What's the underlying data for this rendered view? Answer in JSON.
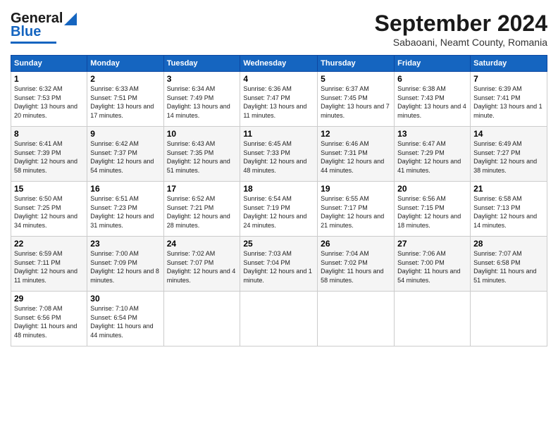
{
  "logo": {
    "part1": "General",
    "part2": "Blue"
  },
  "header": {
    "month_title": "September 2024",
    "subtitle": "Sabaoani, Neamt County, Romania"
  },
  "weekdays": [
    "Sunday",
    "Monday",
    "Tuesday",
    "Wednesday",
    "Thursday",
    "Friday",
    "Saturday"
  ],
  "weeks": [
    [
      {
        "day": "1",
        "sunrise": "6:32 AM",
        "sunset": "7:53 PM",
        "daylight": "13 hours and 20 minutes."
      },
      {
        "day": "2",
        "sunrise": "6:33 AM",
        "sunset": "7:51 PM",
        "daylight": "13 hours and 17 minutes."
      },
      {
        "day": "3",
        "sunrise": "6:34 AM",
        "sunset": "7:49 PM",
        "daylight": "13 hours and 14 minutes."
      },
      {
        "day": "4",
        "sunrise": "6:36 AM",
        "sunset": "7:47 PM",
        "daylight": "13 hours and 11 minutes."
      },
      {
        "day": "5",
        "sunrise": "6:37 AM",
        "sunset": "7:45 PM",
        "daylight": "13 hours and 7 minutes."
      },
      {
        "day": "6",
        "sunrise": "6:38 AM",
        "sunset": "7:43 PM",
        "daylight": "13 hours and 4 minutes."
      },
      {
        "day": "7",
        "sunrise": "6:39 AM",
        "sunset": "7:41 PM",
        "daylight": "13 hours and 1 minute."
      }
    ],
    [
      {
        "day": "8",
        "sunrise": "6:41 AM",
        "sunset": "7:39 PM",
        "daylight": "12 hours and 58 minutes."
      },
      {
        "day": "9",
        "sunrise": "6:42 AM",
        "sunset": "7:37 PM",
        "daylight": "12 hours and 54 minutes."
      },
      {
        "day": "10",
        "sunrise": "6:43 AM",
        "sunset": "7:35 PM",
        "daylight": "12 hours and 51 minutes."
      },
      {
        "day": "11",
        "sunrise": "6:45 AM",
        "sunset": "7:33 PM",
        "daylight": "12 hours and 48 minutes."
      },
      {
        "day": "12",
        "sunrise": "6:46 AM",
        "sunset": "7:31 PM",
        "daylight": "12 hours and 44 minutes."
      },
      {
        "day": "13",
        "sunrise": "6:47 AM",
        "sunset": "7:29 PM",
        "daylight": "12 hours and 41 minutes."
      },
      {
        "day": "14",
        "sunrise": "6:49 AM",
        "sunset": "7:27 PM",
        "daylight": "12 hours and 38 minutes."
      }
    ],
    [
      {
        "day": "15",
        "sunrise": "6:50 AM",
        "sunset": "7:25 PM",
        "daylight": "12 hours and 34 minutes."
      },
      {
        "day": "16",
        "sunrise": "6:51 AM",
        "sunset": "7:23 PM",
        "daylight": "12 hours and 31 minutes."
      },
      {
        "day": "17",
        "sunrise": "6:52 AM",
        "sunset": "7:21 PM",
        "daylight": "12 hours and 28 minutes."
      },
      {
        "day": "18",
        "sunrise": "6:54 AM",
        "sunset": "7:19 PM",
        "daylight": "12 hours and 24 minutes."
      },
      {
        "day": "19",
        "sunrise": "6:55 AM",
        "sunset": "7:17 PM",
        "daylight": "12 hours and 21 minutes."
      },
      {
        "day": "20",
        "sunrise": "6:56 AM",
        "sunset": "7:15 PM",
        "daylight": "12 hours and 18 minutes."
      },
      {
        "day": "21",
        "sunrise": "6:58 AM",
        "sunset": "7:13 PM",
        "daylight": "12 hours and 14 minutes."
      }
    ],
    [
      {
        "day": "22",
        "sunrise": "6:59 AM",
        "sunset": "7:11 PM",
        "daylight": "12 hours and 11 minutes."
      },
      {
        "day": "23",
        "sunrise": "7:00 AM",
        "sunset": "7:09 PM",
        "daylight": "12 hours and 8 minutes."
      },
      {
        "day": "24",
        "sunrise": "7:02 AM",
        "sunset": "7:07 PM",
        "daylight": "12 hours and 4 minutes."
      },
      {
        "day": "25",
        "sunrise": "7:03 AM",
        "sunset": "7:04 PM",
        "daylight": "12 hours and 1 minute."
      },
      {
        "day": "26",
        "sunrise": "7:04 AM",
        "sunset": "7:02 PM",
        "daylight": "11 hours and 58 minutes."
      },
      {
        "day": "27",
        "sunrise": "7:06 AM",
        "sunset": "7:00 PM",
        "daylight": "11 hours and 54 minutes."
      },
      {
        "day": "28",
        "sunrise": "7:07 AM",
        "sunset": "6:58 PM",
        "daylight": "11 hours and 51 minutes."
      }
    ],
    [
      {
        "day": "29",
        "sunrise": "7:08 AM",
        "sunset": "6:56 PM",
        "daylight": "11 hours and 48 minutes."
      },
      {
        "day": "30",
        "sunrise": "7:10 AM",
        "sunset": "6:54 PM",
        "daylight": "11 hours and 44 minutes."
      },
      null,
      null,
      null,
      null,
      null
    ]
  ]
}
